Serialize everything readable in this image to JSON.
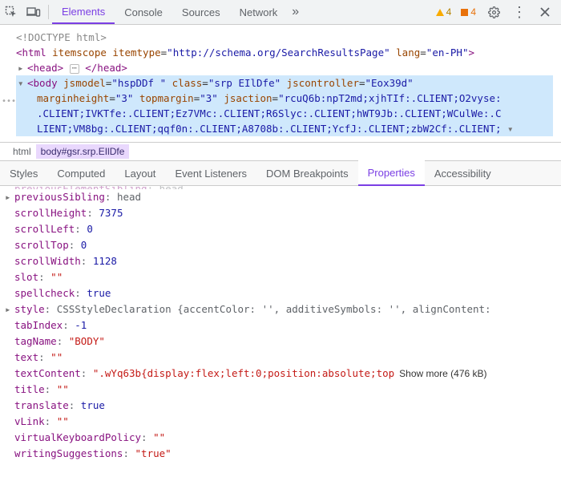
{
  "toolbar": {
    "tabs": [
      "Elements",
      "Console",
      "Sources",
      "Network"
    ],
    "active_tab": 0,
    "warnings_count": "4",
    "issues_count": "4"
  },
  "dom": {
    "doctype": "<!DOCTYPE html>",
    "html_open": "<html ",
    "html_attrs_name1": "itemscope",
    "html_attrs_name2": "itemtype",
    "html_attrs_val2": "\"http://schema.org/SearchResultsPage\"",
    "html_attrs_name3": "lang",
    "html_attrs_val3": "\"en-PH\"",
    "html_close": ">",
    "head_open": "<head>",
    "head_close": "</head>",
    "body_tag": "<body ",
    "body_attrs": [
      [
        "jsmodel",
        "\"hspDDf \""
      ],
      [
        "class",
        "\"srp EIlDfe\""
      ],
      [
        "jscontroller",
        "\"Eox39d\""
      ]
    ],
    "body_line2": [
      [
        "marginheight",
        "\"3\""
      ],
      [
        "topmargin",
        "\"3\""
      ],
      [
        "jsaction",
        "\"rcuQ6b:npT2md;xjhTIf:.CLIENT;O2vyse:"
      ]
    ],
    "body_line3": ".CLIENT;IVKTfe:.CLIENT;Ez7VMc:.CLIENT;R6Slyc:.CLIENT;hWT9Jb:.CLIENT;WCulWe:.C",
    "body_line4": "LIENT;VM8bg:.CLIENT;qqf0n:.CLIENT;A8708b:.CLIENT;YcfJ:.CLIENT;zbW2Cf:.CLIENT;"
  },
  "breadcrumb": {
    "root": "html",
    "leaf": "body#gsr.srp.EIlDfe"
  },
  "subtabs": {
    "items": [
      "Styles",
      "Computed",
      "Layout",
      "Event Listeners",
      "DOM Breakpoints",
      "Properties",
      "Accessibility"
    ],
    "active": 5
  },
  "properties": {
    "top_cut": {
      "k": "previousElementSibling",
      "v": "head"
    },
    "rows": [
      {
        "arrow": true,
        "k": "previousSibling",
        "type": "raw",
        "v": "head"
      },
      {
        "k": "scrollHeight",
        "type": "num",
        "v": "7375"
      },
      {
        "k": "scrollLeft",
        "type": "num",
        "v": "0"
      },
      {
        "k": "scrollTop",
        "type": "num",
        "v": "0"
      },
      {
        "k": "scrollWidth",
        "type": "num",
        "v": "1128"
      },
      {
        "k": "slot",
        "type": "str",
        "v": "\"\""
      },
      {
        "k": "spellcheck",
        "type": "bool",
        "v": "true"
      },
      {
        "arrow": true,
        "k": "style",
        "type": "obj",
        "v": "CSSStyleDeclaration {accentColor: '', additiveSymbols: '', alignContent:"
      },
      {
        "k": "tabIndex",
        "type": "num",
        "v": "-1"
      },
      {
        "k": "tagName",
        "type": "str",
        "v": "\"BODY\""
      },
      {
        "k": "text",
        "type": "str",
        "v": "\"\""
      },
      {
        "k": "textContent",
        "type": "str",
        "v": "\".wYq63b{display:flex;left:0;position:absolute;top",
        "show_more": "Show more (476 kB)"
      },
      {
        "k": "title",
        "type": "str",
        "v": "\"\""
      },
      {
        "k": "translate",
        "type": "bool",
        "v": "true"
      },
      {
        "k": "vLink",
        "type": "str",
        "v": "\"\""
      },
      {
        "k": "virtualKeyboardPolicy",
        "type": "str",
        "v": "\"\""
      },
      {
        "k": "writingSuggestions",
        "type": "str",
        "v": "\"true\""
      }
    ]
  }
}
